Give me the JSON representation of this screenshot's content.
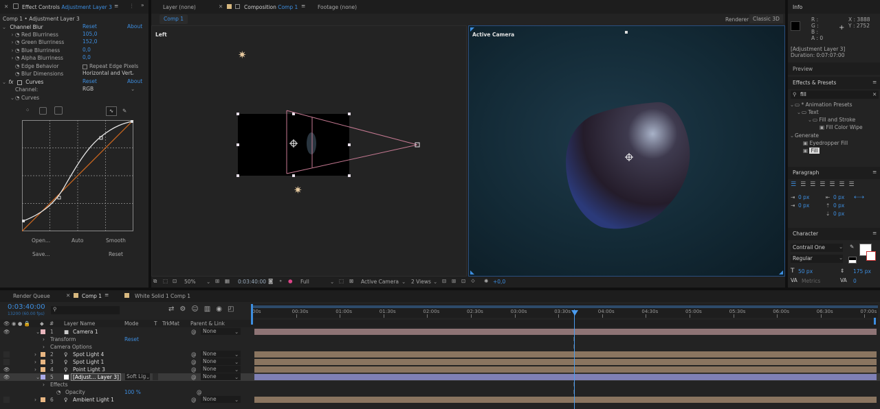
{
  "effect_controls": {
    "tab_title": "Effect Controls",
    "tab_layer": "Adjustment Layer 3",
    "breadcrumb": "Comp 1 • Adjustment Layer 3",
    "channel_blur": {
      "name": "Channel Blur",
      "reset": "Reset",
      "about": "About",
      "params": [
        {
          "label": "Red Blurriness",
          "value": "105,0"
        },
        {
          "label": "Green Blurriness",
          "value": "152,0"
        },
        {
          "label": "Blue Blurriness",
          "value": "0,0"
        },
        {
          "label": "Alpha Blurriness",
          "value": "0,0"
        }
      ],
      "edge_behavior_label": "Edge Behavior",
      "edge_checkbox_label": "Repeat Edge Pixels",
      "blur_dimensions_label": "Blur Dimensions",
      "blur_dimensions_value": "Horizontal and Vert"
    },
    "curves": {
      "fx": "fx",
      "name": "Curves",
      "reset": "Reset",
      "about": "About",
      "channel_label": "Channel:",
      "channel_value": "RGB",
      "sub_label": "Curves",
      "buttons": {
        "open": "Open...",
        "auto": "Auto",
        "smooth": "Smooth",
        "save": "Save...",
        "reset": "Reset"
      }
    }
  },
  "viewer_tabs": {
    "layer": "Layer (none)",
    "composition": "Composition",
    "composition_name": "Comp 1",
    "footage": "Footage (none)",
    "comp_subtab": "Comp 1",
    "renderer_label": "Renderer:",
    "renderer_value": "Classic 3D",
    "left_view_label": "Left",
    "camera_view_label": "Active Camera"
  },
  "viewer_toolbar": {
    "zoom": "50%",
    "timecode": "0:03:40:00",
    "resolution": "Full",
    "camera": "Active Camera",
    "views": "2 Views",
    "exposure": "+0,0"
  },
  "info_panel": {
    "title": "Info",
    "r": "R :",
    "g": "G :",
    "b": "B :",
    "a": "A : 0",
    "x": "X : 3888",
    "y": "Y : 2752",
    "layer_name": "[Adjustment Layer 3]",
    "duration": "Duration: 0:07:07:00",
    "preview": "Preview"
  },
  "effects_presets": {
    "title": "Effects & Presets",
    "search": "fill",
    "tree": [
      {
        "label": "* Animation Presets",
        "level": 0
      },
      {
        "label": "Text",
        "level": 1
      },
      {
        "label": "Fill and Stroke",
        "level": 2
      },
      {
        "label": "Fill Color Wipe",
        "level": 3
      },
      {
        "label": "Generate",
        "level": 0
      },
      {
        "label": "Eyedropper Fill",
        "level": 1
      },
      {
        "label": "Fill",
        "level": 1
      }
    ]
  },
  "paragraph": {
    "title": "Paragraph",
    "indent_left": "0 px",
    "indent_right": "0 px",
    "indent_first": "0 px",
    "space_before": "0 px",
    "space_after": "0 px"
  },
  "character": {
    "title": "Character",
    "font": "Contrail One",
    "style": "Regular",
    "size": "50 px",
    "leading": "175 px",
    "kerning": "Metrics",
    "tracking": "0"
  },
  "timeline": {
    "tabs": {
      "render_queue": "Render Queue",
      "comp": "Comp 1",
      "white_solid": "White Solid 1 Comp 1"
    },
    "current_time": "0:03:40:00",
    "fps": "13200 (60.00 fps)",
    "columns": {
      "layer_name": "Layer Name",
      "mode": "Mode",
      "t": "T",
      "trkmat": "TrkMat",
      "parent": "Parent & Link"
    },
    "ruler": [
      "00s",
      "00:30s",
      "01:00s",
      "01:30s",
      "02:00s",
      "02:30s",
      "03:00s",
      "03:30s",
      "04:00s",
      "04:30s",
      "05:00s",
      "05:30s",
      "06:00s",
      "06:30s",
      "07:00s"
    ],
    "layers": [
      {
        "num": "1",
        "name": "Camera 1",
        "parent": "None",
        "color": "#e9b6bd"
      },
      {
        "prop": "Transform",
        "reset": "Reset"
      },
      {
        "prop": "Camera Options"
      },
      {
        "num": "2",
        "name": "Spot Light 4",
        "parent": "None",
        "color": "#e8b682"
      },
      {
        "num": "3",
        "name": "Spot Light 1",
        "parent": "None",
        "color": "#e8b682"
      },
      {
        "num": "4",
        "name": "Point Light 3",
        "parent": "None",
        "color": "#e8b682"
      },
      {
        "num": "5",
        "name": "[Adjust... Layer 3]",
        "mode": "Soft Lig",
        "parent": "None",
        "color": "#a9a9e8"
      },
      {
        "prop": "Effects"
      },
      {
        "prop": "Opacity",
        "value": "100 %"
      },
      {
        "num": "6",
        "name": "Ambient Light 1",
        "parent": "None",
        "color": "#e8b682"
      }
    ]
  },
  "colors": {
    "accent": "#3d8ee0",
    "camera_bar": "#8e7475",
    "light_bar": "#8a7560",
    "adjustment_bar": "#7f80b5",
    "playhead": "#4a9cf0"
  }
}
